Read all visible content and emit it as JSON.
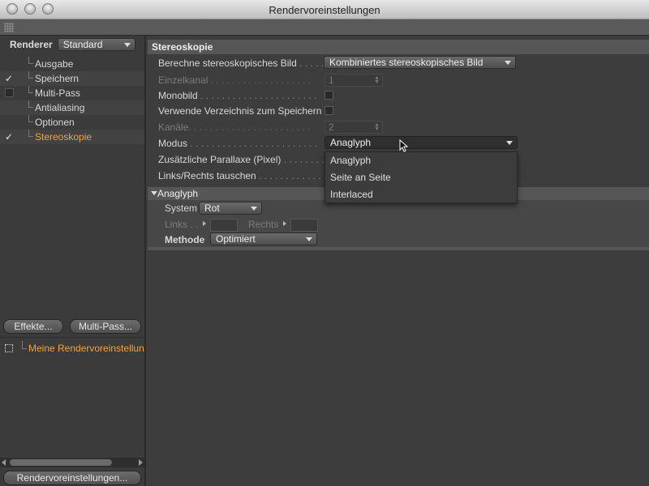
{
  "window": {
    "title": "Rendervoreinstellungen"
  },
  "sidebar": {
    "renderer_label": "Renderer",
    "renderer_value": "Standard",
    "items": [
      {
        "label": "Ausgabe",
        "check": ""
      },
      {
        "label": "Speichern",
        "check": "checked"
      },
      {
        "label": "Multi-Pass",
        "check": "unchecked"
      },
      {
        "label": "Antialiasing",
        "check": ""
      },
      {
        "label": "Optionen",
        "check": ""
      },
      {
        "label": "Stereoskopie",
        "check": "checked",
        "active": true
      }
    ],
    "effects_button": "Effekte...",
    "multipass_button": "Multi-Pass...",
    "render_settings_item": "Meine Rendervoreinstellun",
    "render_settings_button": "Rendervoreinstellungen...",
    "checkmark_glyph": "✓"
  },
  "stereo": {
    "section_title": "Stereoskopie",
    "rows": {
      "compute": {
        "label": "Berechne stereoskopisches Bild",
        "dots": " . . . . .",
        "value": "Kombiniertes stereoskopisches Bild"
      },
      "single_channel": {
        "label": "Einzelkanal",
        "dots": " . . . . . . . . . . . . . . . . . . .",
        "value": "1"
      },
      "mono": {
        "label": "Monobild",
        "dots": " . . . . . . . . . . . . . . . . . . . . . ."
      },
      "use_dir": {
        "label": "Verwende Verzeichnis zum Speichern"
      },
      "channels": {
        "label": "Kanäle",
        "dots": ". . . . . . . . . . . . . . . . . . . . . . .",
        "value": "2"
      },
      "mode": {
        "label": "Modus",
        "dots": " . . . . . . . . . . . . . . . . . . . . . . . .",
        "value": "Anaglyph"
      },
      "parallax": {
        "label": "Zusätzliche Parallaxe (Pixel)",
        "dots": " . . . . . . . ."
      },
      "swap": {
        "label": "Links/Rechts tauschen",
        "dots": " . . . . . . . . . . . ."
      }
    },
    "mode_menu": [
      "Anaglyph",
      "Seite an Seite",
      "Interlaced"
    ],
    "anaglyph": {
      "title": "Anaglyph",
      "system_label": "System",
      "system_value": "Rot",
      "left_label": "Links . .",
      "right_label": "Rechts",
      "method_label": "Methode",
      "method_value": "Optimiert"
    }
  },
  "colors": {
    "accent": "#f4a33a",
    "panel": "#3d3d3d",
    "header": "#565656"
  }
}
